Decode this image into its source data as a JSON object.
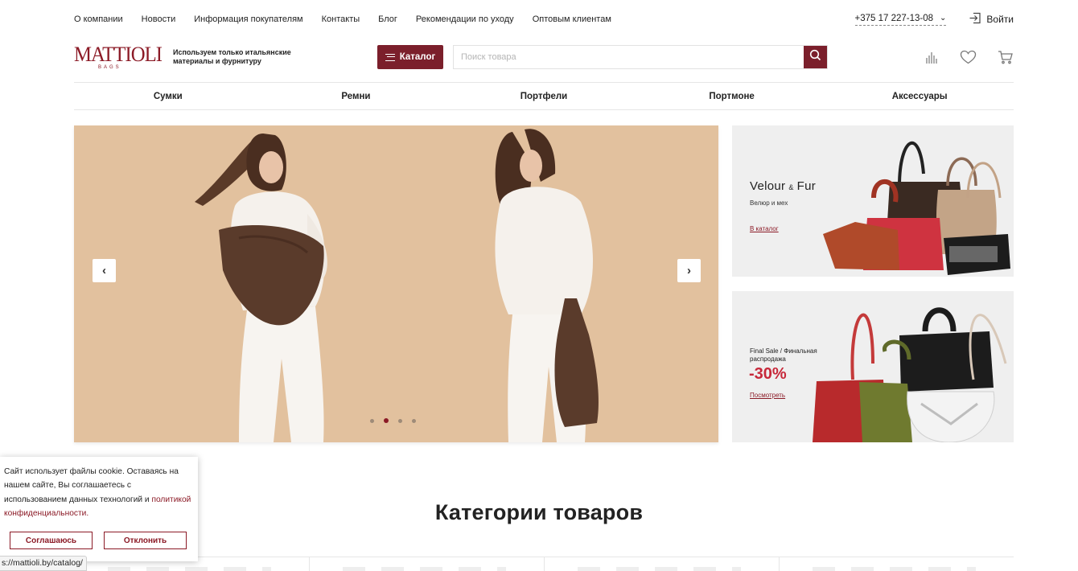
{
  "topnav": [
    "О компании",
    "Новости",
    "Информация покупателям",
    "Контакты",
    "Блог",
    "Рекомендации по уходу",
    "Оптовым клиентам"
  ],
  "phone": "+375 17 227-13-08",
  "login_label": "Войти",
  "logo": {
    "text": "MATTIOLI",
    "sub": "BAGS"
  },
  "tagline": "Используем только итальянские материалы и фурнитуру",
  "catalog_label": "Каталог",
  "search_placeholder": "Поиск товара",
  "categories_nav": [
    "Сумки",
    "Ремни",
    "Портфели",
    "Портмоне",
    "Аксессуары"
  ],
  "hero": {
    "prev": "‹",
    "next": "›",
    "slide_count": 4,
    "active_slide": 2
  },
  "promo1": {
    "title_a": "Velour",
    "amp": "&",
    "title_b": "Fur",
    "subtitle": "Велюр и мех",
    "link": "В каталог"
  },
  "promo2": {
    "title": "Final Sale / Финальная распродажа",
    "discount": "-30%",
    "link": "Посмотреть"
  },
  "categories_heading": "Категории товаров",
  "cookie": {
    "text": "Сайт использует файлы cookie. Оставаясь на нашем сайте, Вы соглашаетесь с использованием данных технологий и ",
    "policy_link": "политикой конфиденциальности.",
    "accept": "Соглашаюсь",
    "decline": "Отклонить"
  },
  "status_url": "s://mattioli.by/catalog/",
  "colors": {
    "brand": "#7b1f2b",
    "hero_bg": "#e2c19e",
    "sale": "#c7283a"
  }
}
